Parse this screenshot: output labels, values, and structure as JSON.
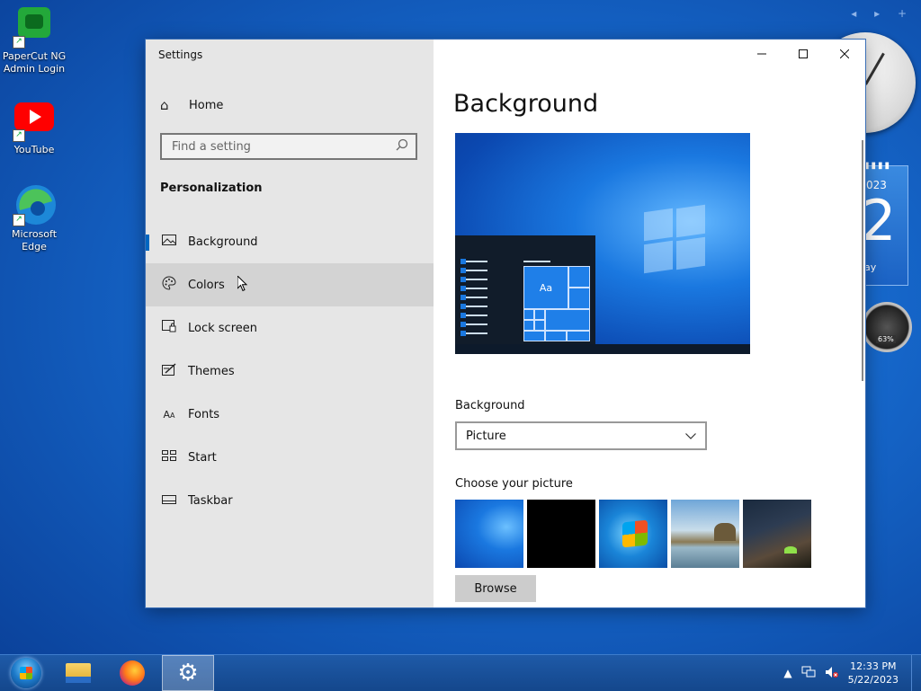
{
  "desktop": {
    "icons": [
      {
        "label_line1": "PaperCut NG",
        "label_line2": "Admin Login",
        "icon": "papercut-icon"
      },
      {
        "label_line1": "YouTube",
        "label_line2": "",
        "icon": "youtube-icon"
      },
      {
        "label_line1": "Microsoft",
        "label_line2": "Edge",
        "icon": "edge-icon"
      }
    ],
    "gadget_nav": "◂ ▸ +",
    "calendar": {
      "year": "023",
      "day": "2",
      "weekday": "ay"
    },
    "meter": {
      "value": "63%"
    }
  },
  "window": {
    "title": "Settings",
    "buttons": {
      "minimize": "—",
      "maximize": "☐",
      "close": "✕"
    }
  },
  "sidebar": {
    "home_label": "Home",
    "search_placeholder": "Find a setting",
    "section_title": "Personalization",
    "items": [
      {
        "label": "Background",
        "icon": "picture-icon"
      },
      {
        "label": "Colors",
        "icon": "palette-icon"
      },
      {
        "label": "Lock screen",
        "icon": "lock-screen-icon"
      },
      {
        "label": "Themes",
        "icon": "themes-icon"
      },
      {
        "label": "Fonts",
        "icon": "fonts-icon"
      },
      {
        "label": "Start",
        "icon": "start-icon"
      },
      {
        "label": "Taskbar",
        "icon": "taskbar-icon"
      }
    ],
    "selected": "Background",
    "hovered": "Colors"
  },
  "main": {
    "heading": "Background",
    "preview_tile_text": "Aa",
    "background_label": "Background",
    "background_value": "Picture",
    "choose_label": "Choose your picture",
    "browse_label": "Browse"
  },
  "taskbar": {
    "time": "12:33 PM",
    "date": "5/22/2023",
    "apps": [
      "start-orb",
      "file-explorer",
      "firefox",
      "settings"
    ]
  },
  "colors": {
    "accent": "#0067c0",
    "sidebar_bg": "#e6e6e6",
    "taskbar": "#1e5aa8"
  }
}
